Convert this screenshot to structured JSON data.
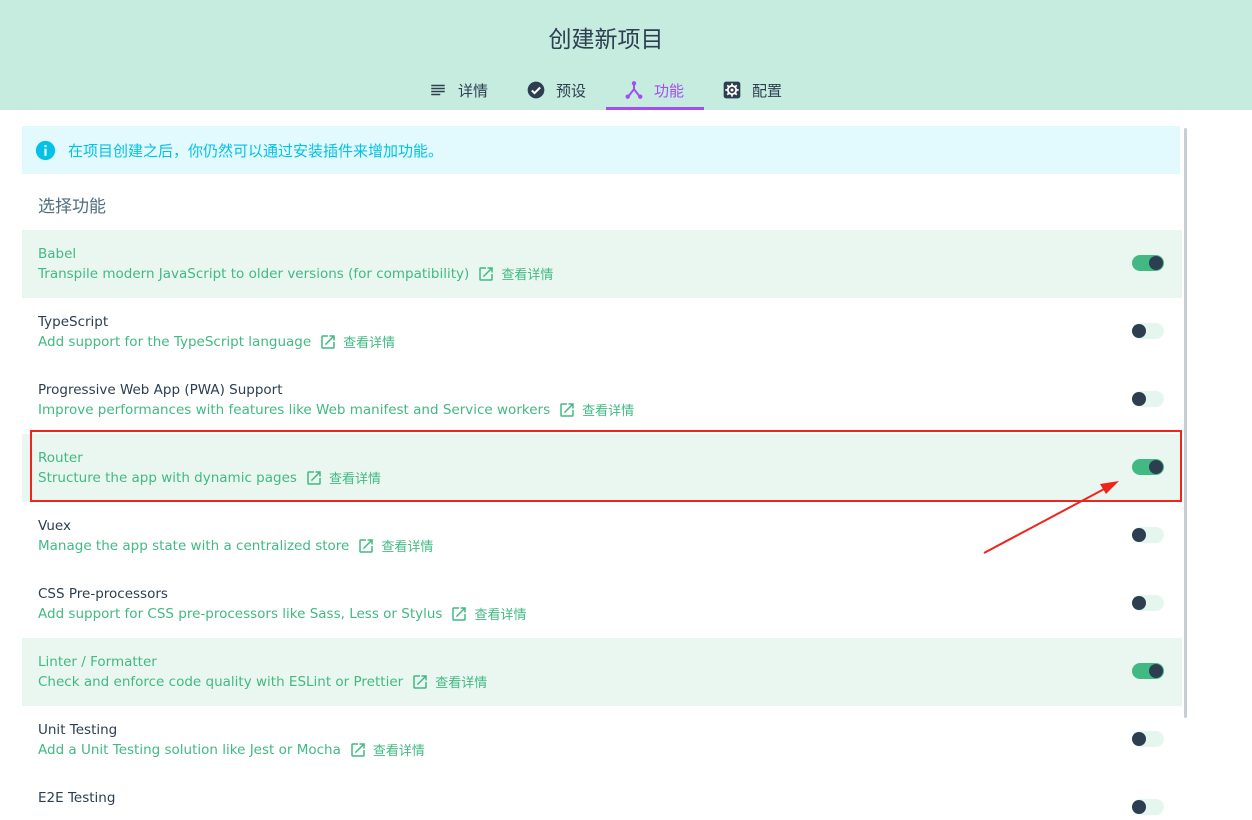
{
  "header": {
    "title": "创建新项目",
    "tabs": [
      {
        "label": "详情",
        "icon": "list-icon"
      },
      {
        "label": "预设",
        "icon": "check-circle-icon"
      },
      {
        "label": "功能",
        "icon": "merge-type-icon",
        "active": true
      },
      {
        "label": "配置",
        "icon": "settings-icon"
      }
    ]
  },
  "info": {
    "text": "在项目创建之后，你仍然可以通过安装插件来增加功能。",
    "icon": "info-icon"
  },
  "section_title": "选择功能",
  "more_label": "查看详情",
  "features": [
    {
      "name": "Babel",
      "desc": "Transpile modern JavaScript to older versions (for compatibility)",
      "enabled": true
    },
    {
      "name": "TypeScript",
      "desc": "Add support for the TypeScript language",
      "enabled": false
    },
    {
      "name": "Progressive Web App (PWA) Support",
      "desc": "Improve performances with features like Web manifest and Service workers",
      "enabled": false
    },
    {
      "name": "Router",
      "desc": "Structure the app with dynamic pages",
      "enabled": true
    },
    {
      "name": "Vuex",
      "desc": "Manage the app state with a centralized store",
      "enabled": false
    },
    {
      "name": "CSS Pre-processors",
      "desc": "Add support for CSS pre-processors like Sass, Less or Stylus",
      "enabled": false
    },
    {
      "name": "Linter / Formatter",
      "desc": "Check and enforce code quality with ESLint or Prettier",
      "enabled": true
    },
    {
      "name": "Unit Testing",
      "desc": "Add a Unit Testing solution like Jest or Mocha",
      "enabled": false
    },
    {
      "name": "E2E Testing",
      "desc": "",
      "enabled": false
    }
  ],
  "colors": {
    "header_bg": "#c6ebdf",
    "accent": "#42b983",
    "active_tab": "#a44cf6",
    "info_text": "#03c2e6",
    "annotation": "#f0241b"
  }
}
